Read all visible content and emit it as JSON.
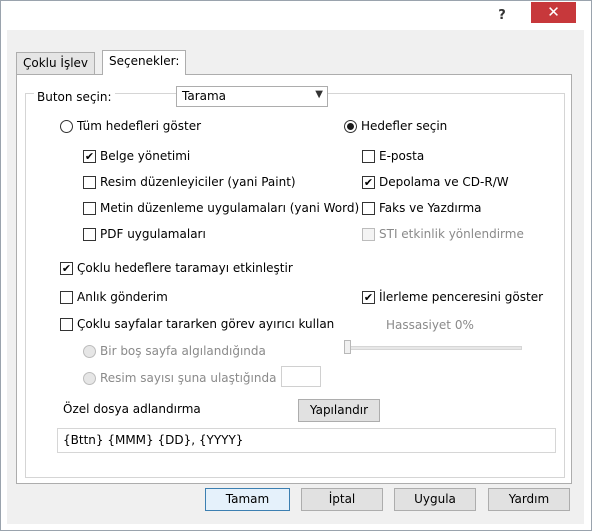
{
  "titlebar": {
    "help_label": "?",
    "close_label": "✕"
  },
  "tabs": [
    {
      "label": "Çoklu İşlev"
    },
    {
      "label": "Seçenekler:"
    }
  ],
  "button_select": {
    "label": "Buton seçin:",
    "value": "Tarama"
  },
  "radios": {
    "all_targets": "Tüm hedefleri göster",
    "select_targets": "Hedefler seçin"
  },
  "targets": {
    "document_mgmt": "Belge yönetimi",
    "image_editors": "Resim düzenleyiciler (yani Paint)",
    "text_editors": "Metin düzenleme uygulamaları (yani Word)",
    "pdf_apps": "PDF uygulamaları",
    "email": "E-posta",
    "storage": "Depolama ve CD-R/W",
    "fax_print": "Faks ve Yazdırma",
    "sti": "STI etkinlik yönlendirme"
  },
  "options": {
    "multi_target": "Çoklu hedeflere taramayı etkinleştir",
    "instant_send": "Anlık gönderim",
    "show_progress": "İlerleme penceresini göster",
    "separator": "Çoklu sayfalar tararken görev ayırıcı kullan",
    "sensitivity": "Hassasiyet  0%",
    "blank_page": "Bir boş sayfa algılandığında",
    "image_count": "Resim sayısı şuna ulaştığında"
  },
  "naming": {
    "label": "Özel dosya adlandırma",
    "configure": "Yapılandır",
    "pattern": "{Bttn} {MMM} {DD}, {YYYY}"
  },
  "footer": {
    "ok": "Tamam",
    "cancel": "İptal",
    "apply": "Uygula",
    "help": "Yardım"
  },
  "colors": {
    "close": "#c7383b",
    "panel": "#f0f0f0",
    "default_button_border": "#3c7fb1"
  }
}
